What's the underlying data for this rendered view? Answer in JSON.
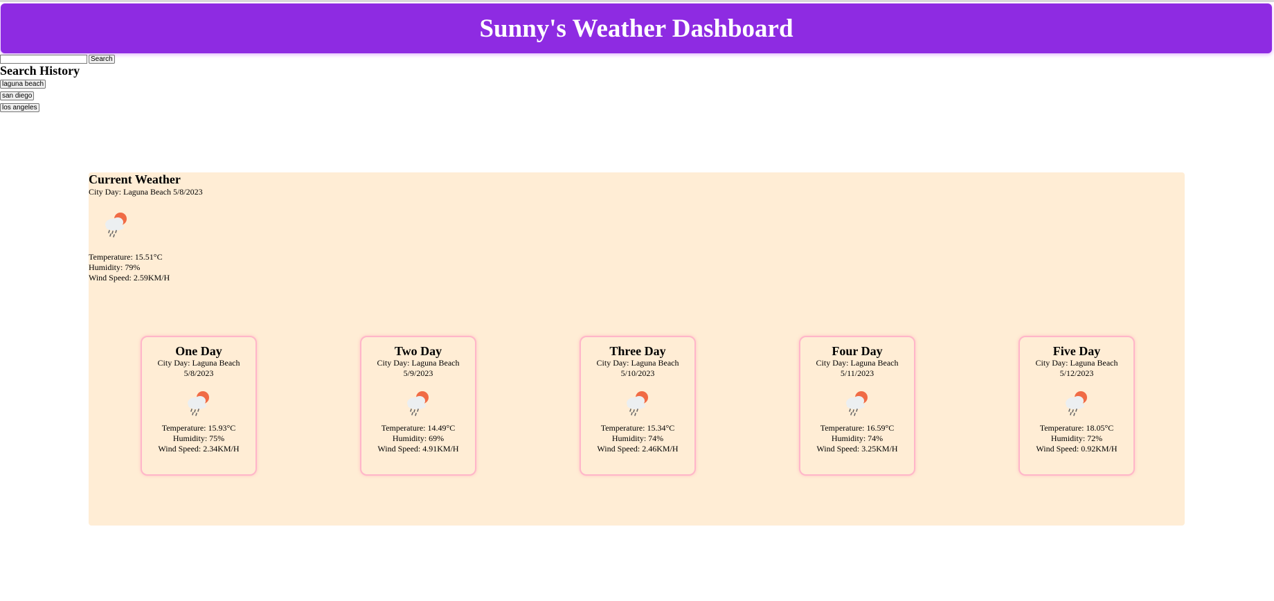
{
  "header": {
    "title": "Sunny's Weather Dashboard"
  },
  "search": {
    "value": "",
    "placeholder": "",
    "button_label": "Search"
  },
  "history": {
    "title": "Search History",
    "items": [
      "laguna beach",
      "san diego",
      "los angeles"
    ]
  },
  "current": {
    "title": "Current Weather",
    "city_day": "City Day: Laguna Beach 5/8/2023",
    "icon": "rain-cloud-sun-icon",
    "temperature": "Temperature: 15.51°C",
    "humidity": "Humidity: 79%",
    "wind": "Wind Speed: 2.59KM/H"
  },
  "forecast": [
    {
      "title": "One Day",
      "city_day": "City Day: Laguna Beach",
      "date": "5/8/2023",
      "icon": "rain-cloud-sun-icon",
      "temperature": "Temperature: 15.93°C",
      "humidity": "Humidity: 75%",
      "wind": "Wind Speed: 2.34KM/H"
    },
    {
      "title": "Two Day",
      "city_day": "City Day: Laguna Beach",
      "date": "5/9/2023",
      "icon": "rain-cloud-sun-icon",
      "temperature": "Temperature: 14.49°C",
      "humidity": "Humidity: 69%",
      "wind": "Wind Speed: 4.91KM/H"
    },
    {
      "title": "Three Day",
      "city_day": "City Day: Laguna Beach",
      "date": "5/10/2023",
      "icon": "rain-cloud-sun-icon",
      "temperature": "Temperature: 15.34°C",
      "humidity": "Humidity: 74%",
      "wind": "Wind Speed: 2.46KM/H"
    },
    {
      "title": "Four Day",
      "city_day": "City Day: Laguna Beach",
      "date": "5/11/2023",
      "icon": "rain-cloud-sun-icon",
      "temperature": "Temperature: 16.59°C",
      "humidity": "Humidity: 74%",
      "wind": "Wind Speed: 3.25KM/H"
    },
    {
      "title": "Five Day",
      "city_day": "City Day: Laguna Beach",
      "date": "5/12/2023",
      "icon": "rain-cloud-sun-icon",
      "temperature": "Temperature: 18.05°C",
      "humidity": "Humidity: 72%",
      "wind": "Wind Speed: 0.92KM/H"
    }
  ],
  "colors": {
    "header_bg": "#8e2be2",
    "panel_bg": "#ffedd5",
    "card_border": "#ffb6c9",
    "sun": "#f06b45",
    "cloud": "#eceff1",
    "rain": "#666666"
  }
}
